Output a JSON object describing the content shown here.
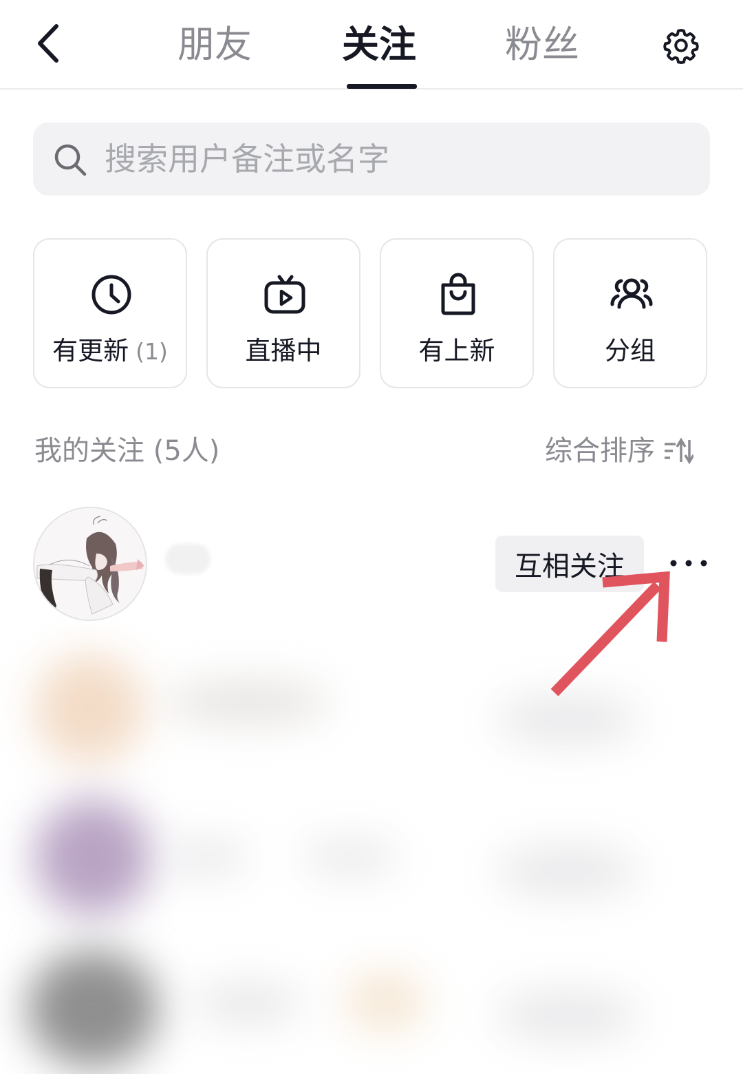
{
  "header": {
    "tabs": [
      {
        "label": "朋友",
        "active": false
      },
      {
        "label": "关注",
        "active": true
      },
      {
        "label": "粉丝",
        "active": false
      }
    ],
    "back_icon": "chevron-left-icon",
    "settings_icon": "gear-icon"
  },
  "search": {
    "placeholder": "搜索用户备注或名字",
    "value": "",
    "icon": "search-icon"
  },
  "quick_actions": [
    {
      "label": "有更新",
      "count": "(1)",
      "icon": "clock-icon"
    },
    {
      "label": "直播中",
      "icon": "tv-play-icon"
    },
    {
      "label": "有上新",
      "icon": "shopping-bag-icon"
    },
    {
      "label": "分组",
      "icon": "group-icon"
    }
  ],
  "list": {
    "title": "我的关注 (5人)",
    "sort_label": "综合排序",
    "sort_icon": "sort-icon",
    "users": [
      {
        "name": "",
        "button_label": "互相关注",
        "more_icon": "more-icon"
      }
    ]
  },
  "colors": {
    "primary_text": "#161823",
    "secondary_text": "#8a8b91",
    "button_bg": "#f0f0f2",
    "annotation_arrow": "#e0545e"
  }
}
